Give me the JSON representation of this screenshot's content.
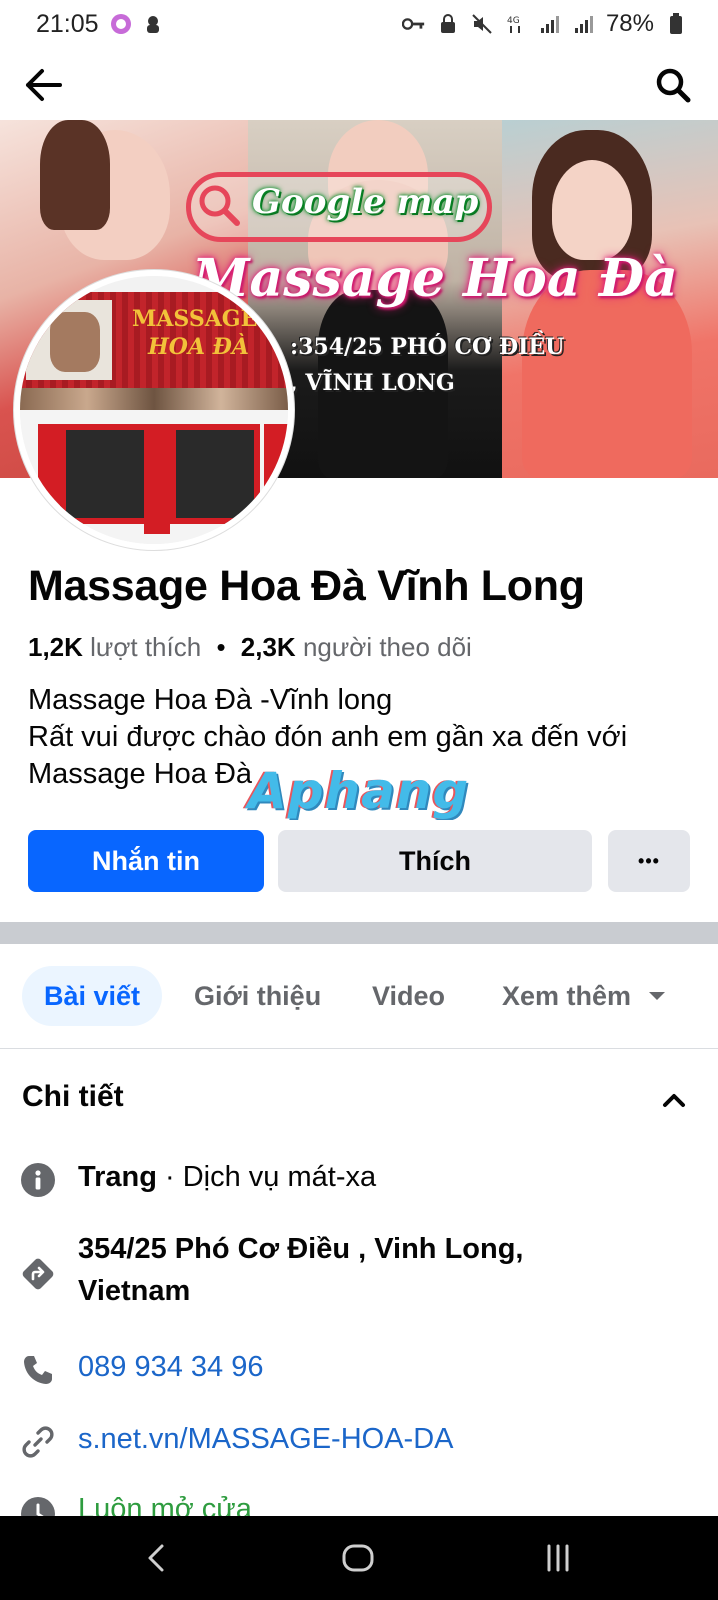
{
  "status_bar": {
    "time": "21:05",
    "battery": "78%"
  },
  "cover": {
    "google_map": "Google map",
    "title": "Massage Hoa Đà",
    "address_line1": ":354/25 PHÓ CƠ ĐIỀU",
    "address_line2": ", VĨNH LONG"
  },
  "avatar": {
    "sign_line1": "MASSAGE",
    "sign_line2": "HOA ĐÀ"
  },
  "page": {
    "name": "Massage Hoa Đà Vĩnh Long",
    "likes_count": "1,2K",
    "likes_label": "lượt thích",
    "separator": "•",
    "followers_count": "2,3K",
    "followers_label": "người theo dõi",
    "bio_line1": "Massage Hoa Đà -Vĩnh long",
    "bio_line2": "Rất vui được chào đón anh em gần xa đến với",
    "bio_line3": "Massage Hoa Đà"
  },
  "watermark": "Aphang",
  "actions": {
    "message": "Nhắn tin",
    "like": "Thích",
    "more": "•••"
  },
  "tabs": [
    {
      "label": "Bài viết"
    },
    {
      "label": "Giới thiệu"
    },
    {
      "label": "Video"
    },
    {
      "label": "Xem thêm"
    }
  ],
  "details": {
    "title": "Chi tiết",
    "category_prefix": "Trang",
    "category": " · Dịch vụ mát-xa",
    "address_line1": "354/25 Phó Cơ Điều , Vinh Long,",
    "address_line2": "Vietnam",
    "phone": "089 934 34 96",
    "website": "s.net.vn/MASSAGE-HOA-DA",
    "hours": "Luôn mở cửa"
  },
  "colors": {
    "primary": "#0866ff",
    "secondary_button": "#e4e6eb",
    "link": "#1b66c9",
    "open": "#2e9c3f"
  }
}
